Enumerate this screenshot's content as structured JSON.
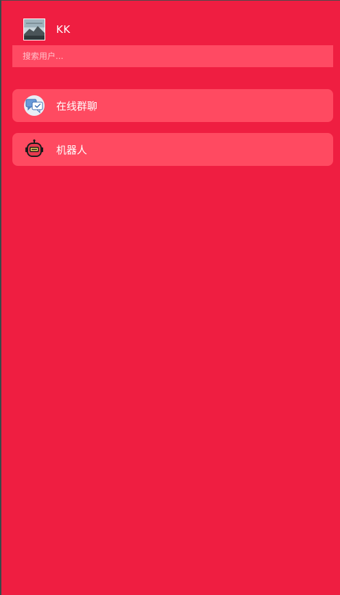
{
  "user": {
    "name": "KK",
    "avatar_icon": "landscape-avatar-icon"
  },
  "search": {
    "placeholder": "搜索用户..."
  },
  "chats": [
    {
      "label": "在线群聊",
      "icon": "group-chat-icon"
    },
    {
      "label": "机器人",
      "icon": "robot-icon"
    }
  ],
  "colors": {
    "background": "#ef1e41",
    "item_background": "#ff4a61",
    "text": "#ffffff"
  }
}
